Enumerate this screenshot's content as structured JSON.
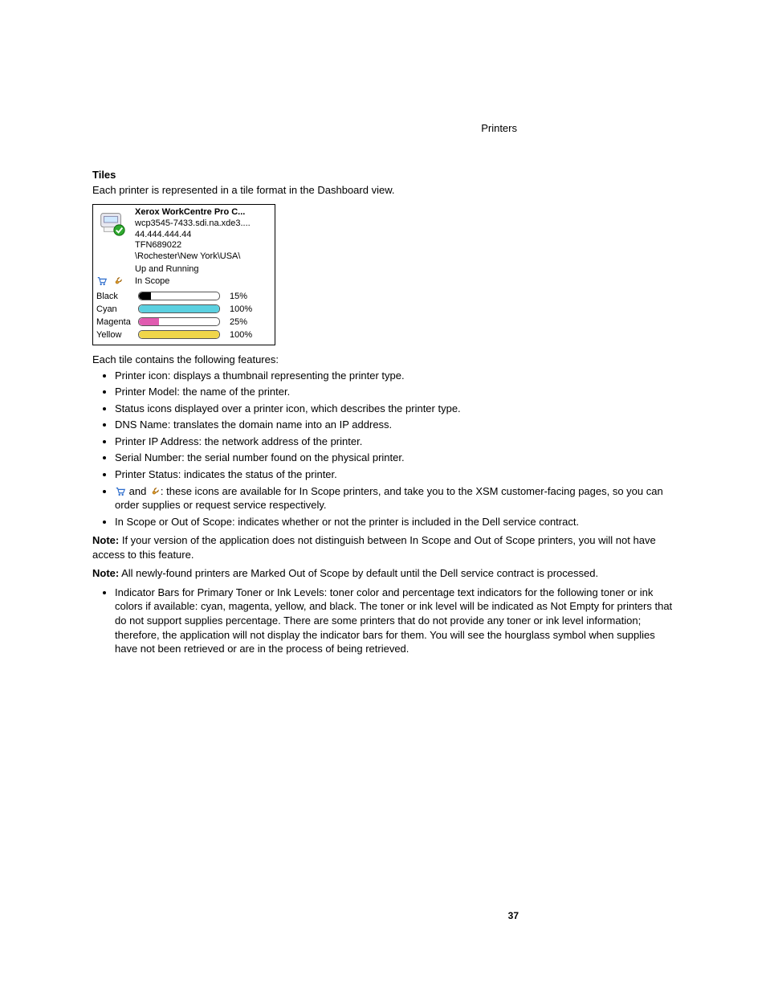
{
  "header": {
    "section": "Printers"
  },
  "heading": "Tiles",
  "intro": "Each printer is represented in a tile format in the Dashboard view.",
  "tile": {
    "title": "Xerox WorkCentre Pro C...",
    "dns": "wcp3545-7433.sdi.na.xde3....",
    "ip": "44.444.444.44",
    "serial": "TFN689022",
    "location": "\\Rochester\\New York\\USA\\",
    "status": "Up and Running",
    "scope": "In Scope",
    "toners": [
      {
        "name": "Black",
        "pct": "15%",
        "fill": 15,
        "color": "#000000"
      },
      {
        "name": "Cyan",
        "pct": "100%",
        "fill": 100,
        "color": "#5bd0e0"
      },
      {
        "name": "Magenta",
        "pct": "25%",
        "fill": 25,
        "color": "#e05bb0"
      },
      {
        "name": "Yellow",
        "pct": "100%",
        "fill": 100,
        "color": "#f0d64a"
      }
    ]
  },
  "features_intro": "Each tile contains the following features:",
  "features": [
    "Printer icon: displays a thumbnail representing the printer type.",
    "Printer Model: the name of the printer.",
    "Status icons displayed over a printer icon, which describes the printer type.",
    "DNS Name: translates the domain name into an IP address.",
    "Printer IP Address: the network address of the printer.",
    "Serial Number: the serial number found on the physical printer.",
    "Printer Status: indicates the status of the printer."
  ],
  "icon_feature": {
    "and": " and ",
    "text": ": these icons are available for In Scope printers, and take you to the XSM customer-facing pages, so you can order supplies or request service respectively."
  },
  "scope_feature": "In Scope or Out of Scope: indicates whether or not the printer is included in the Dell service contract.",
  "note1": {
    "bold": "Note:",
    "text": " If your version of the application does not distinguish between In Scope and Out of Scope printers, you will not have access to this feature."
  },
  "note2": {
    "bold": "Note:",
    "text": " All newly-found printers are Marked Out of Scope by default until the Dell service contract is processed."
  },
  "indicator_feature": "Indicator Bars for Primary Toner or Ink Levels: toner color and percentage text indicators for the following toner or ink colors if available: cyan, magenta, yellow, and black. The toner or ink level will be indicated as Not Empty for printers that do not support supplies percentage. There are some printers that do not provide any toner or ink level information; therefore, the application will not display the indicator bars for them. You will see the hourglass symbol when supplies have not been retrieved or are in the process of being retrieved.",
  "page_number": "37"
}
